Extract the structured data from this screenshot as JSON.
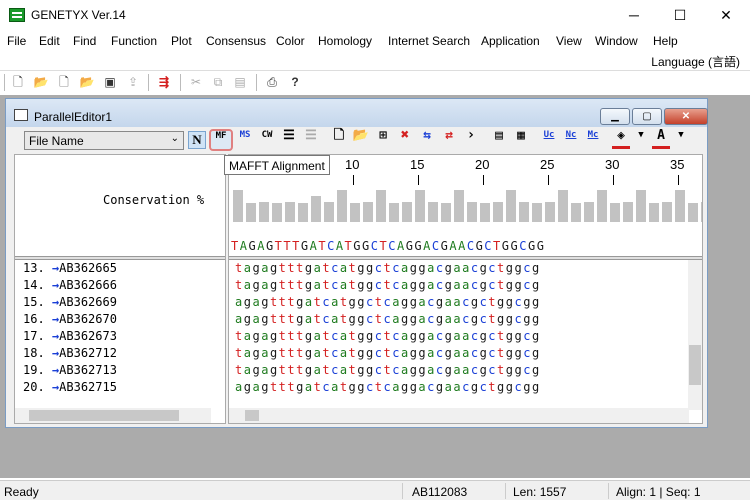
{
  "window": {
    "title": "GENETYX Ver.14",
    "minimize_glyph": "─",
    "maximize_glyph": "☐",
    "close_glyph": "✕"
  },
  "menu": [
    "File",
    "Edit",
    "Find",
    "Function",
    "Plot",
    "Consensus",
    "Color",
    "Homology",
    "Internet Search",
    "Application",
    "View",
    "Window",
    "Help"
  ],
  "language_label": "Language (言語)",
  "main_toolbar_icons": [
    "new-file-icon",
    "open-folder-icon",
    "new-document-icon",
    "open-file-icon",
    "save-icon",
    "upload-icon",
    "parallel-editor-icon",
    "cut-icon",
    "copy-icon",
    "paste-icon",
    "print-icon",
    "help-icon"
  ],
  "child_window": {
    "title": "ParallelEditor1",
    "min_glyph": "▁",
    "max_glyph": "▢",
    "close_glyph": "✕"
  },
  "editor_toolbar": {
    "dropdown_value": "File Name",
    "n_button_label": "N",
    "mafft_label": "MF",
    "ms_label": "MS",
    "cw_label": "CW",
    "right_arrow": "›",
    "uc_label": "Uc",
    "nc_label": "Nc",
    "mc_label": "Mc",
    "text_color_label": "A"
  },
  "tooltip": "MAFFT Alignment",
  "ruler_ticks": [
    "10",
    "15",
    "20",
    "25",
    "30",
    "35"
  ],
  "conservation_label": "Conservation %",
  "conservation_levels": [
    0.95,
    0.55,
    0.6,
    0.55,
    0.6,
    0.55,
    0.75,
    0.6,
    0.95,
    0.55,
    0.6,
    0.95,
    0.55,
    0.6,
    0.95,
    0.6,
    0.55,
    0.95,
    0.6,
    0.55,
    0.6,
    0.95,
    0.6,
    0.55,
    0.6,
    0.95,
    0.55,
    0.6,
    0.95,
    0.55,
    0.6,
    0.95,
    0.55,
    0.6,
    0.95,
    0.55,
    0.6,
    0.95,
    0.6,
    0.55,
    0.6,
    0.95,
    0.55
  ],
  "consensus_sequence": "TAGAGTTTGATCATGGCTCAGGACGAACGCTGGCGG",
  "names": [
    {
      "num": "13.",
      "id": "AB362665"
    },
    {
      "num": "14.",
      "id": "AB362666"
    },
    {
      "num": "15.",
      "id": "AB362669"
    },
    {
      "num": "16.",
      "id": "AB362670"
    },
    {
      "num": "17.",
      "id": "AB362673"
    },
    {
      "num": "18.",
      "id": "AB362712"
    },
    {
      "num": "19.",
      "id": "AB362713"
    },
    {
      "num": "20.",
      "id": "AB362715"
    }
  ],
  "sequences": [
    "tagagtttgatcatggctcaggacgaacgctggcg",
    "tagagtttgatcatggctcaggacgaacgctggcg",
    "agagtttgatcatggctcaggacgaacgctggcgg",
    "agagtttgatcatggctcaggacgaacgctggcgg",
    "tagagtttgatcatggctcaggacgaacgctggcg",
    "tagagtttgatcatggctcaggacgaacgctggcg",
    "tagagtttgatcatggctcaggacgaacgctggcg",
    "agagtttgatcatggctcaggacgaacgctggcgg"
  ],
  "base_colors": {
    "a": "#1e7b1e",
    "t": "#d42020",
    "g": "#1a1a1a",
    "c": "#1a3fd6"
  },
  "status": {
    "ready": "Ready",
    "accession": "AB112083",
    "length": "Len: 1557",
    "align": "Align: 1 | Seq: 1"
  }
}
